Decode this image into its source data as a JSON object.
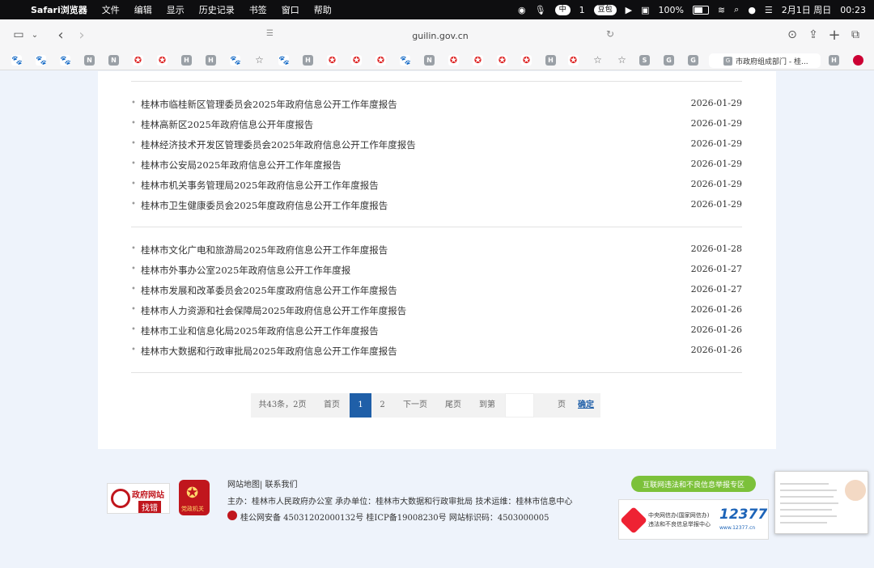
{
  "menubar": {
    "app_name": "Safari浏览器",
    "items": [
      "文件",
      "编辑",
      "显示",
      "历史记录",
      "书签",
      "窗口",
      "帮助"
    ],
    "status_pill": "豆包",
    "ime": "中",
    "battery": "100%",
    "date": "2月1日 周日",
    "time": "00:23",
    "notif_count": "1"
  },
  "toolbar": {
    "url": "guilin.gov.cn"
  },
  "favorites": {
    "tab_label": "市政府组成部门 - 桂..."
  },
  "list_group_1": [
    {
      "title": "桂林市临桂新区管理委员会2025年政府信息公开工作年度报告",
      "date": "2026-01-29"
    },
    {
      "title": "桂林高新区2025年政府信息公开年度报告",
      "date": "2026-01-29"
    },
    {
      "title": "桂林经济技术开发区管理委员会2025年政府信息公开工作年度报告",
      "date": "2026-01-29"
    },
    {
      "title": "桂林市公安局2025年政府信息公开工作年度报告",
      "date": "2026-01-29"
    },
    {
      "title": "桂林市机关事务管理局2025年政府信息公开工作年度报告",
      "date": "2026-01-29"
    },
    {
      "title": "桂林市卫生健康委员会2025年度政府信息公开工作年度报告",
      "date": "2026-01-29"
    }
  ],
  "list_group_2": [
    {
      "title": "桂林市文化广电和旅游局2025年政府信息公开工作年度报告",
      "date": "2026-01-28"
    },
    {
      "title": "桂林市外事办公室2025年政府信息公开工作年度报",
      "date": "2026-01-27"
    },
    {
      "title": "桂林市发展和改革委员会2025年度政府信息公开工作年度报告",
      "date": "2026-01-27"
    },
    {
      "title": "桂林市人力资源和社会保障局2025年政府信息公开工作年度报告",
      "date": "2026-01-26"
    },
    {
      "title": "桂林市工业和信息化局2025年政府信息公开工作年度报告",
      "date": "2026-01-26"
    },
    {
      "title": "桂林市大数据和行政审批局2025年政府信息公开工作年度报告",
      "date": "2026-01-26"
    }
  ],
  "pager": {
    "summary": "共43条，2页",
    "first": "首页",
    "page1": "1",
    "page2": "2",
    "next": "下一页",
    "last": "尾页",
    "goto": "到第",
    "page_unit": "页",
    "confirm": "确定"
  },
  "footer": {
    "logo1_title": "政府网站",
    "logo1_sub": "找错",
    "logo2_text": "党政机关",
    "links": "网站地图| 联系我们",
    "sponsor": "主办：桂林市人民政府办公室 承办单位：桂林市大数据和行政审批局 技术运维：桂林市信息中心",
    "icp": "桂公网安备 45031202000132号 桂ICP备19008230号    网站标识码：4503000005",
    "badge_green": "互联网违法和不良信息举报专区",
    "report_line1": "中央网信办(国家网信办)",
    "report_line2": "违法和不良信息举报中心",
    "report_number": "12377",
    "report_url": "www.12377.cn"
  }
}
